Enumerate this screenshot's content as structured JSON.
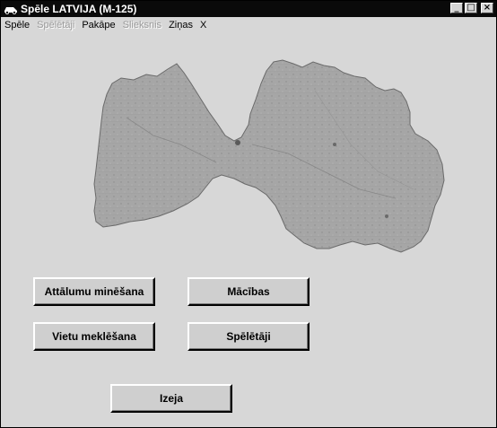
{
  "window": {
    "title": "Spēle LATVIJA (M-125)",
    "controls": {
      "minimize": "_",
      "maximize": "□",
      "close": "×"
    }
  },
  "menu": [
    {
      "label": "Spēle",
      "enabled": true
    },
    {
      "label": "Spēlētāji",
      "enabled": false
    },
    {
      "label": "Pakāpe",
      "enabled": true
    },
    {
      "label": "Slieksnis",
      "enabled": false
    },
    {
      "label": "Ziņas",
      "enabled": true
    },
    {
      "label": "X",
      "enabled": true
    }
  ],
  "buttons": {
    "distance_guess": "Attālumu minēšana",
    "training": "Mācības",
    "place_search": "Vietu meklēšana",
    "players": "Spēlētāji",
    "exit": "Izeja"
  },
  "colors": {
    "titlebar": "#0a0a0a",
    "window_bg": "#d7d7d7",
    "map_fill": "#a9a9a9"
  }
}
